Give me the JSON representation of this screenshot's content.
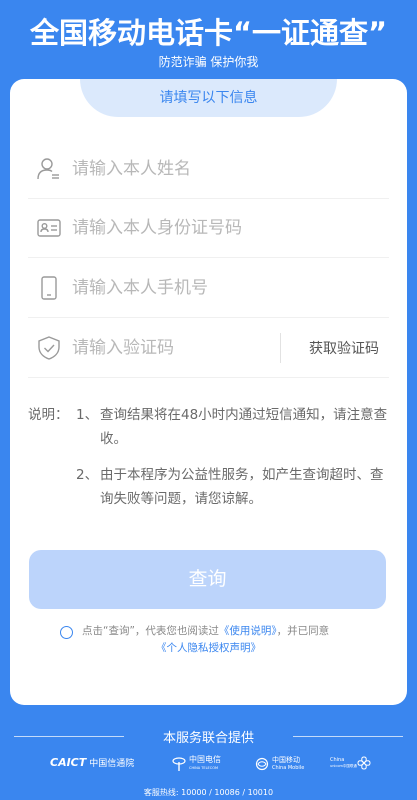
{
  "header": {
    "title": "全国移动电话卡“一证通查”",
    "subtitle": "防范诈骗 保护你我"
  },
  "form": {
    "tab_label": "请填写以下信息",
    "name_placeholder": "请输入本人姓名",
    "id_placeholder": "请输入本人身份证号码",
    "phone_placeholder": "请输入本人手机号",
    "code_placeholder": "请输入验证码",
    "code_button": "获取验证码"
  },
  "notes": {
    "lead": "说明：",
    "items": [
      {
        "num": "1、",
        "text": "查询结果将在48小时内通过短信通知，请注意查收。"
      },
      {
        "num": "2、",
        "text": "由于本程序为公益性服务，如产生查询超时、查询失败等问题，请您谅解。"
      }
    ]
  },
  "query_button": "查询",
  "agreement": {
    "prefix": "点击“查询”，代表您也阅读过",
    "link1": "《使用说明》",
    "middle": "，并已同意",
    "link2": "《个人隐私授权声明》"
  },
  "footer": {
    "title": "本服务联合提供",
    "logos": [
      {
        "brand": "CAICT",
        "name": "中国信通院"
      },
      {
        "brand": "中国电信",
        "sub": "CHINA TELECOM"
      },
      {
        "brand": "中国移动",
        "sub": "China Mobile"
      },
      {
        "brand": "China",
        "sub": "unicom中国联通"
      }
    ],
    "hotline": "客服热线: 10000 / 10086 / 10010"
  },
  "colors": {
    "primary": "#3a86ef",
    "tab_bg": "#dbe9fc",
    "button_disabled": "#bcd4fb"
  }
}
